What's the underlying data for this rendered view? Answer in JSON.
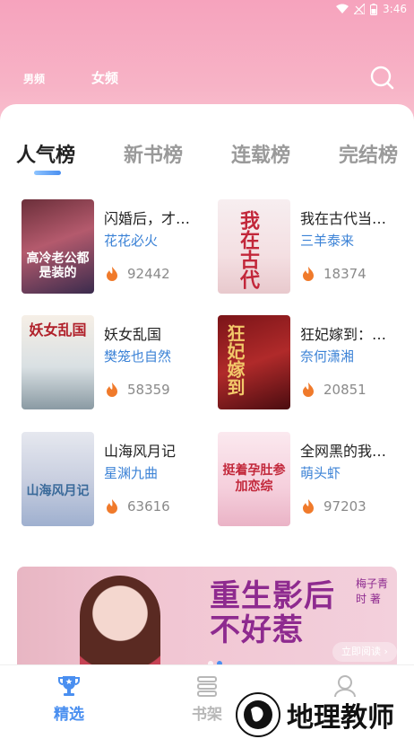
{
  "status_bar": {
    "time": "3:46"
  },
  "channels": {
    "male": "男频",
    "female": "女频"
  },
  "rank_tabs": [
    "人气榜",
    "新书榜",
    "连载榜",
    "完结榜"
  ],
  "books": [
    {
      "title": "闪婚后，才…",
      "author": "花花必火",
      "hot": "92442",
      "cover_text": "高冷老公都是装的"
    },
    {
      "title": "我在古代当…",
      "author": "三羊泰来",
      "hot": "18374",
      "cover_text": "我在古代"
    },
    {
      "title": "妖女乱国",
      "author": "樊笼也自然",
      "hot": "58359",
      "cover_text": "妖女乱国"
    },
    {
      "title": "狂妃嫁到：…",
      "author": "奈何潇湘",
      "hot": "20851",
      "cover_text": "狂妃嫁到"
    },
    {
      "title": "山海风月记",
      "author": "星渊九曲",
      "hot": "63616",
      "cover_text": "山海风月记"
    },
    {
      "title": "全网黑的我…",
      "author": "萌头虾",
      "hot": "97203",
      "cover_text": "挺着孕肚参加恋综"
    }
  ],
  "banner": {
    "title_line1": "重生影后",
    "title_line2": "不好惹",
    "author": "梅子青时 著",
    "button": "立即阅读 ›"
  },
  "bottom_nav": {
    "featured": "精选",
    "bookshelf": "书架"
  },
  "watermark": {
    "text": "地理教师"
  },
  "colors": {
    "accent": "#4a8ff0",
    "header_pink": "#f6a3bd",
    "author_blue": "#3b82d6",
    "fire": "#f07a2b"
  }
}
